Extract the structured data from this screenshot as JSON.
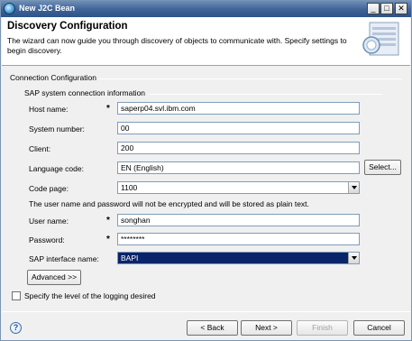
{
  "window": {
    "title": "New J2C Bean"
  },
  "header": {
    "title": "Discovery Configuration",
    "description": "The wizard can now guide you through discovery of objects to communicate with.  Specify settings to begin discovery.",
    "banner_icon": "discovery-wizard-icon"
  },
  "connection": {
    "group_label": "Connection Configuration",
    "sap_group_label": "SAP system connection information",
    "host": {
      "label": "Host name:",
      "value": "saperp04.svl.ibm.com",
      "required": "*"
    },
    "system_number": {
      "label": "System number:",
      "value": "00"
    },
    "client": {
      "label": "Client:",
      "value": "200"
    },
    "language": {
      "label": "Language code:",
      "value": "EN (English)",
      "select_button": "Select..."
    },
    "code_page": {
      "label": "Code page:",
      "value": "1100"
    },
    "encrypt_note": "The user name and password will not be encrypted and will be stored as plain text.",
    "user": {
      "label": "User name:",
      "value": "songhan",
      "required": "*"
    },
    "password": {
      "label": "Password:",
      "value": "********",
      "required": "*"
    },
    "interface": {
      "label": "SAP interface name:",
      "value": "BAPI"
    },
    "advanced_button": "Advanced >>",
    "logging_checkbox_label": "Specify the level of the logging desired"
  },
  "footer": {
    "help_icon": "help-icon",
    "back": "< Back",
    "next": "Next >",
    "finish": "Finish",
    "cancel": "Cancel"
  },
  "colors": {
    "titlebar": "#3d6296",
    "selection": "#0a246a",
    "field_border": "#7f9db9"
  }
}
